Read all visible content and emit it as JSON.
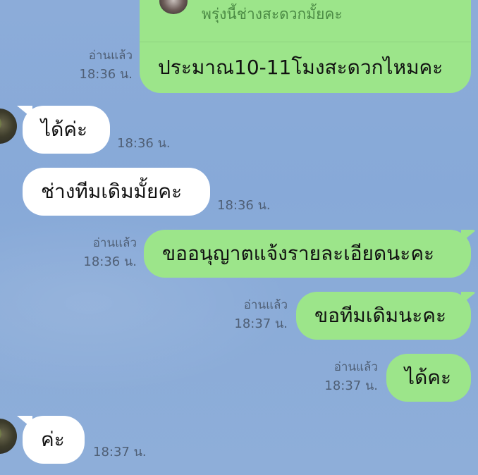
{
  "reply_preview": {
    "text": "พรุ่งนี้ช่างสะดวกมั้ยคะ"
  },
  "messages": [
    {
      "direction": "outgoing",
      "text": "ประมาณ10-11โมงสะดวกไหมคะ",
      "read": "อ่านแล้ว",
      "time": "18:36 น."
    },
    {
      "direction": "incoming",
      "text": "ได้ค่ะ",
      "time": "18:36 น."
    },
    {
      "direction": "incoming",
      "text": "ช่างทีมเดิมมั้ยคะ",
      "time": "18:36 น."
    },
    {
      "direction": "outgoing",
      "text": "ขออนุญาตแจ้งรายละเอียดนะคะ",
      "read": "อ่านแล้ว",
      "time": "18:36 น."
    },
    {
      "direction": "outgoing",
      "text": "ขอทีมเดิมนะคะ",
      "read": "อ่านแล้ว",
      "time": "18:37 น."
    },
    {
      "direction": "outgoing",
      "text": "ได้คะ",
      "read": "อ่านแล้ว",
      "time": "18:37 น."
    },
    {
      "direction": "incoming",
      "text": "ค่ะ",
      "time": "18:37 น."
    }
  ],
  "colors": {
    "background": "#8aabd8",
    "outgoing_bubble": "#9ce58a",
    "incoming_bubble": "#ffffff",
    "meta_text": "#4f5f75"
  }
}
